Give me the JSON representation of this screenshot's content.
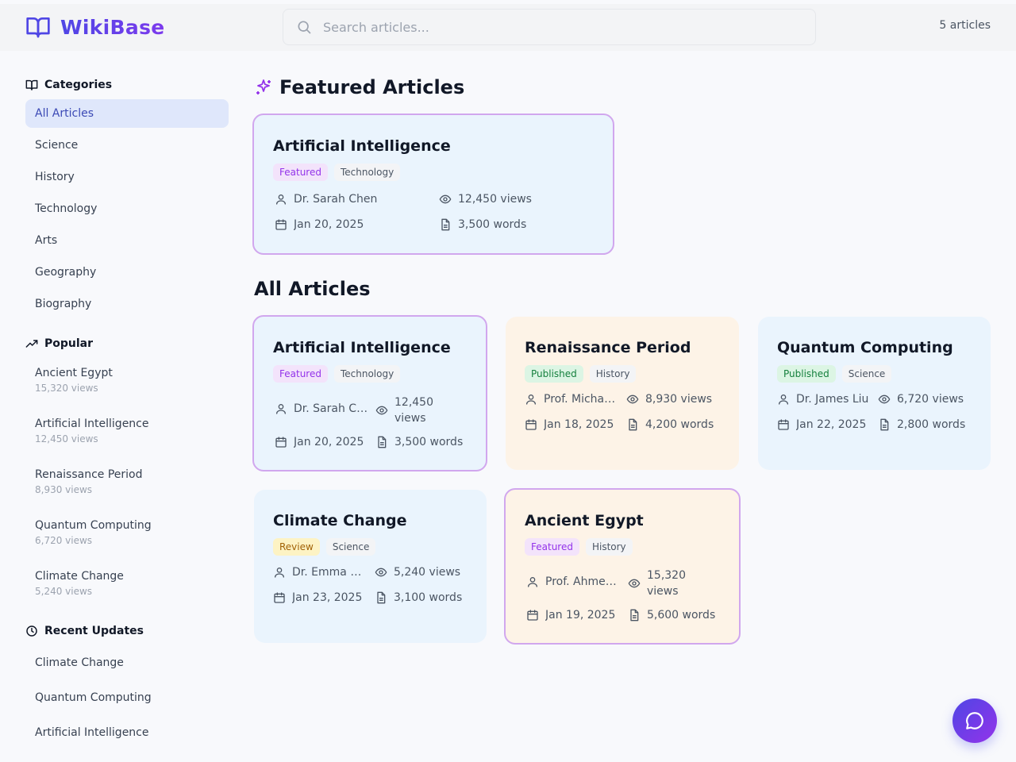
{
  "app": {
    "name": "WikiBase",
    "article_count": "5 articles",
    "logo_icon": "book-open-icon"
  },
  "search": {
    "placeholder": "Search articles..."
  },
  "colors": {
    "accent": "#4f46e5",
    "accent2": "#7c3aed",
    "active_bg": "#dfe7fb",
    "featured_border": "#d1a7ee"
  },
  "sidebar": {
    "categories_title": "Categories",
    "categories": [
      "All Articles",
      "Science",
      "History",
      "Technology",
      "Arts",
      "Geography",
      "Biography"
    ],
    "popular_title": "Popular",
    "popular": [
      {
        "title": "Ancient Egypt",
        "views": "15,320 views"
      },
      {
        "title": "Artificial Intelligence",
        "views": "12,450 views"
      },
      {
        "title": "Renaissance Period",
        "views": "8,930 views"
      },
      {
        "title": "Quantum Computing",
        "views": "6,720 views"
      },
      {
        "title": "Climate Change",
        "views": "5,240 views"
      }
    ],
    "recent_title": "Recent Updates",
    "recent": [
      "Climate Change",
      "Quantum Computing",
      "Artificial Intelligence"
    ]
  },
  "main": {
    "featured_title": "Featured Articles",
    "all_title": "All Articles",
    "featured": [
      {
        "title": "Artificial Intelligence",
        "status": "Featured",
        "category": "Technology",
        "author": "Dr. Sarah Chen",
        "views": "12,450 views",
        "date": "Jan 20, 2025",
        "words": "3,500 words"
      }
    ],
    "articles": [
      {
        "title": "Artificial Intelligence",
        "status": "Featured",
        "category": "Technology",
        "author": "Dr. Sarah Chen",
        "views": "12,450 views",
        "date": "Jan 20, 2025",
        "words": "3,500 words"
      },
      {
        "title": "Renaissance Period",
        "status": "Published",
        "category": "History",
        "author": "Prof. Michael Rossi",
        "views": "8,930 views",
        "date": "Jan 18, 2025",
        "words": "4,200 words"
      },
      {
        "title": "Quantum Computing",
        "status": "Published",
        "category": "Science",
        "author": "Dr. James Liu",
        "views": "6,720 views",
        "date": "Jan 22, 2025",
        "words": "2,800 words"
      },
      {
        "title": "Climate Change",
        "status": "Review",
        "category": "Science",
        "author": "Dr. Emma Rodriguez",
        "views": "5,240 views",
        "date": "Jan 23, 2025",
        "words": "3,100 words"
      },
      {
        "title": "Ancient Egypt",
        "status": "Featured",
        "category": "History",
        "author": "Prof. Ahmed Hassan",
        "views": "15,320 views",
        "date": "Jan 19, 2025",
        "words": "5,600 words"
      }
    ]
  },
  "fab": {
    "icon": "chat-bubble-icon"
  }
}
